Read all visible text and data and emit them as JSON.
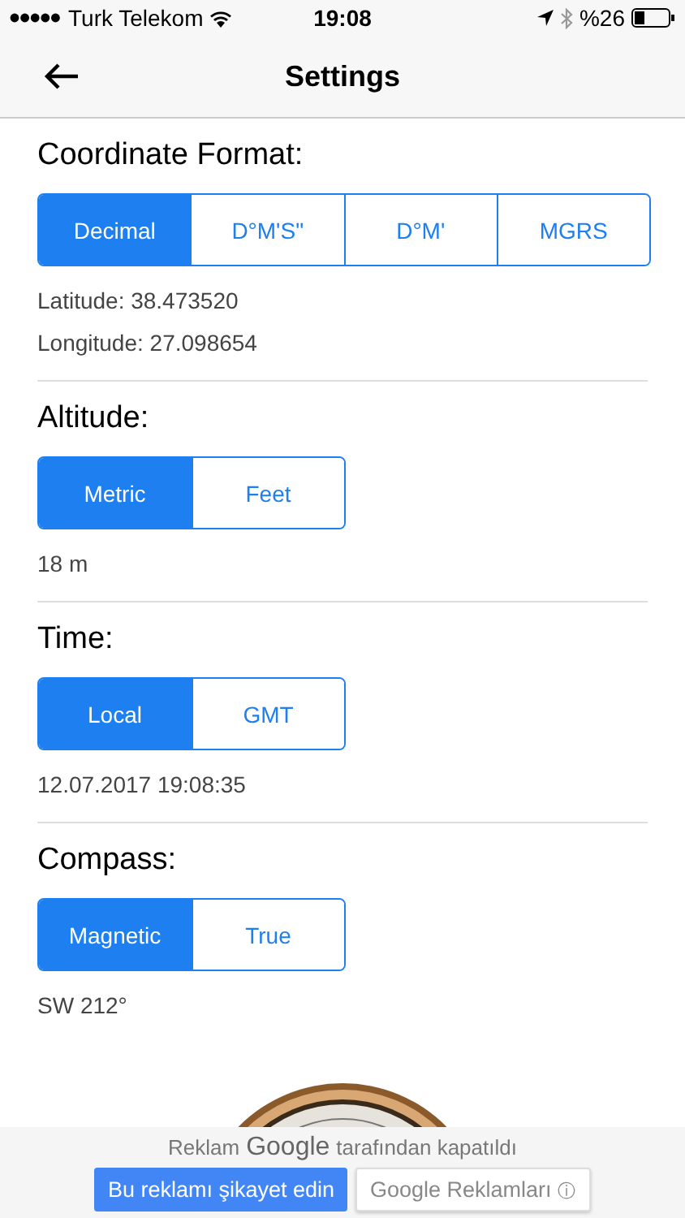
{
  "status_bar": {
    "carrier": "Turk Telekom",
    "time": "19:08",
    "battery": "%26"
  },
  "nav": {
    "title": "Settings"
  },
  "sections": [
    {
      "title": "Coordinate Format:",
      "options": [
        {
          "label": "Decimal",
          "selected": true
        },
        {
          "label": "D°M'S\"",
          "selected": false
        },
        {
          "label": "D°M'",
          "selected": false
        },
        {
          "label": "MGRS",
          "selected": false
        }
      ],
      "lines": [
        "Latitude: 38.473520",
        "Longitude: 27.098654"
      ]
    },
    {
      "title": "Altitude:",
      "options": [
        {
          "label": "Metric",
          "selected": true
        },
        {
          "label": "Feet",
          "selected": false
        }
      ],
      "lines": [
        "18 m"
      ]
    },
    {
      "title": "Time:",
      "options": [
        {
          "label": "Local",
          "selected": true
        },
        {
          "label": "GMT",
          "selected": false
        }
      ],
      "lines": [
        "12.07.2017 19:08:35"
      ]
    },
    {
      "title": "Compass:",
      "options": [
        {
          "label": "Magnetic",
          "selected": true
        },
        {
          "label": "True",
          "selected": false
        }
      ],
      "lines": [
        "SW 212°"
      ]
    }
  ],
  "ad": {
    "prefix": "Reklam",
    "logo": "Google",
    "suffix": "tarafından kapatıldı",
    "report_button": "Bu reklamı şikayet edin",
    "ads_button": "Google Reklamları",
    "info": "ⓘ"
  }
}
